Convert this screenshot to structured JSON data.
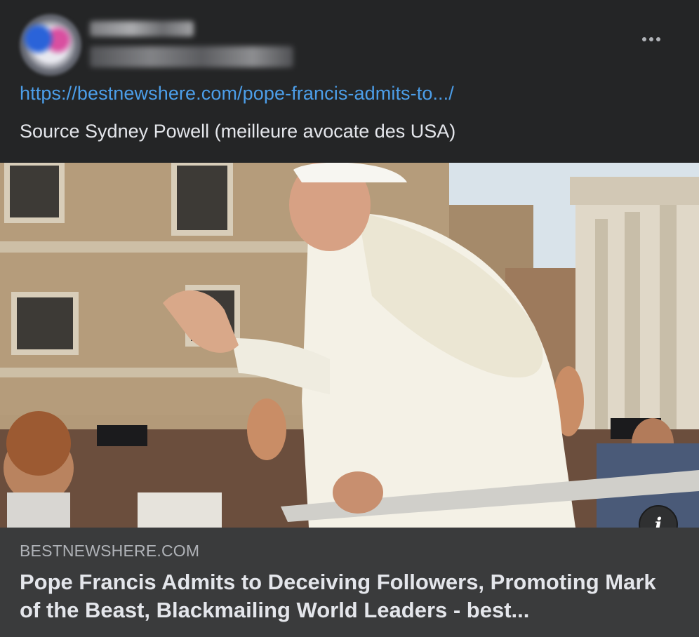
{
  "post": {
    "link_url": "https://bestnewshere.com/pope-francis-admits-to.../",
    "caption": "Source Sydney Powell (meilleure avocate des USA)"
  },
  "link_preview": {
    "domain": "BESTNEWSHERE.COM",
    "title": "Pope Francis Admits to Deceiving Followers, Promoting Mark of the Beast, Blackmailing World Leaders - best..."
  },
  "icons": {
    "more": "more-options-icon",
    "info": "info-icon",
    "info_glyph": "i"
  },
  "colors": {
    "background": "#242526",
    "link": "#4c9ee9",
    "footer": "#3a3b3c"
  }
}
